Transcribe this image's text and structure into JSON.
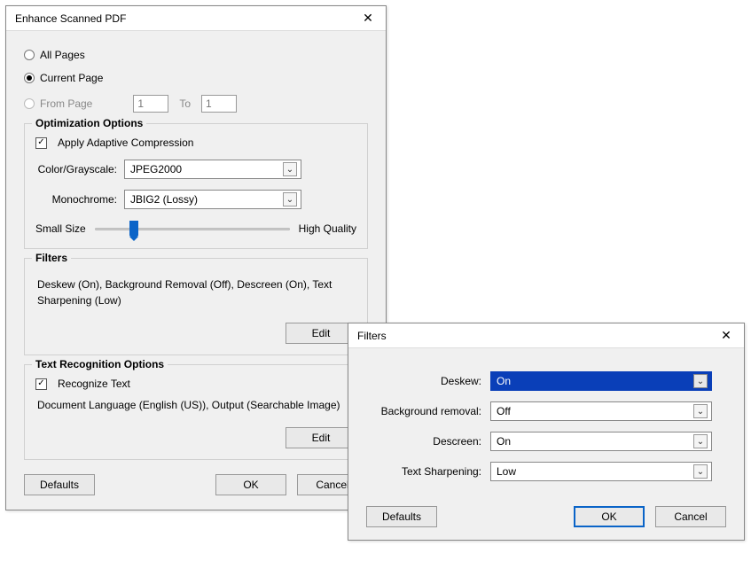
{
  "main": {
    "title": "Enhance Scanned PDF",
    "radios": {
      "all_pages": "All Pages",
      "current_page": "Current Page",
      "from_page": "From Page",
      "to": "To",
      "from_value": "1",
      "to_value": "1"
    },
    "opt_group": {
      "title": "Optimization Options",
      "apply_adaptive": "Apply Adaptive Compression",
      "color_label": "Color/Grayscale:",
      "color_value": "JPEG2000",
      "mono_label": "Monochrome:",
      "mono_value": "JBIG2 (Lossy)",
      "small_size": "Small Size",
      "high_quality": "High Quality"
    },
    "filters_group": {
      "title": "Filters",
      "summary": "Deskew (On), Background Removal (Off), Descreen (On), Text Sharpening (Low)",
      "edit": "Edit"
    },
    "text_rec": {
      "title": "Text Recognition Options",
      "recognize": "Recognize Text",
      "summary": "Document Language (English (US)), Output (Searchable Image)",
      "edit": "Edit"
    },
    "buttons": {
      "defaults": "Defaults",
      "ok": "OK",
      "cancel": "Cancel"
    }
  },
  "filters": {
    "title": "Filters",
    "rows": {
      "deskew_label": "Deskew:",
      "deskew_value": "On",
      "bg_label": "Background removal:",
      "bg_value": "Off",
      "descreen_label": "Descreen:",
      "descreen_value": "On",
      "sharpen_label": "Text Sharpening:",
      "sharpen_value": "Low"
    },
    "buttons": {
      "defaults": "Defaults",
      "ok": "OK",
      "cancel": "Cancel"
    }
  }
}
